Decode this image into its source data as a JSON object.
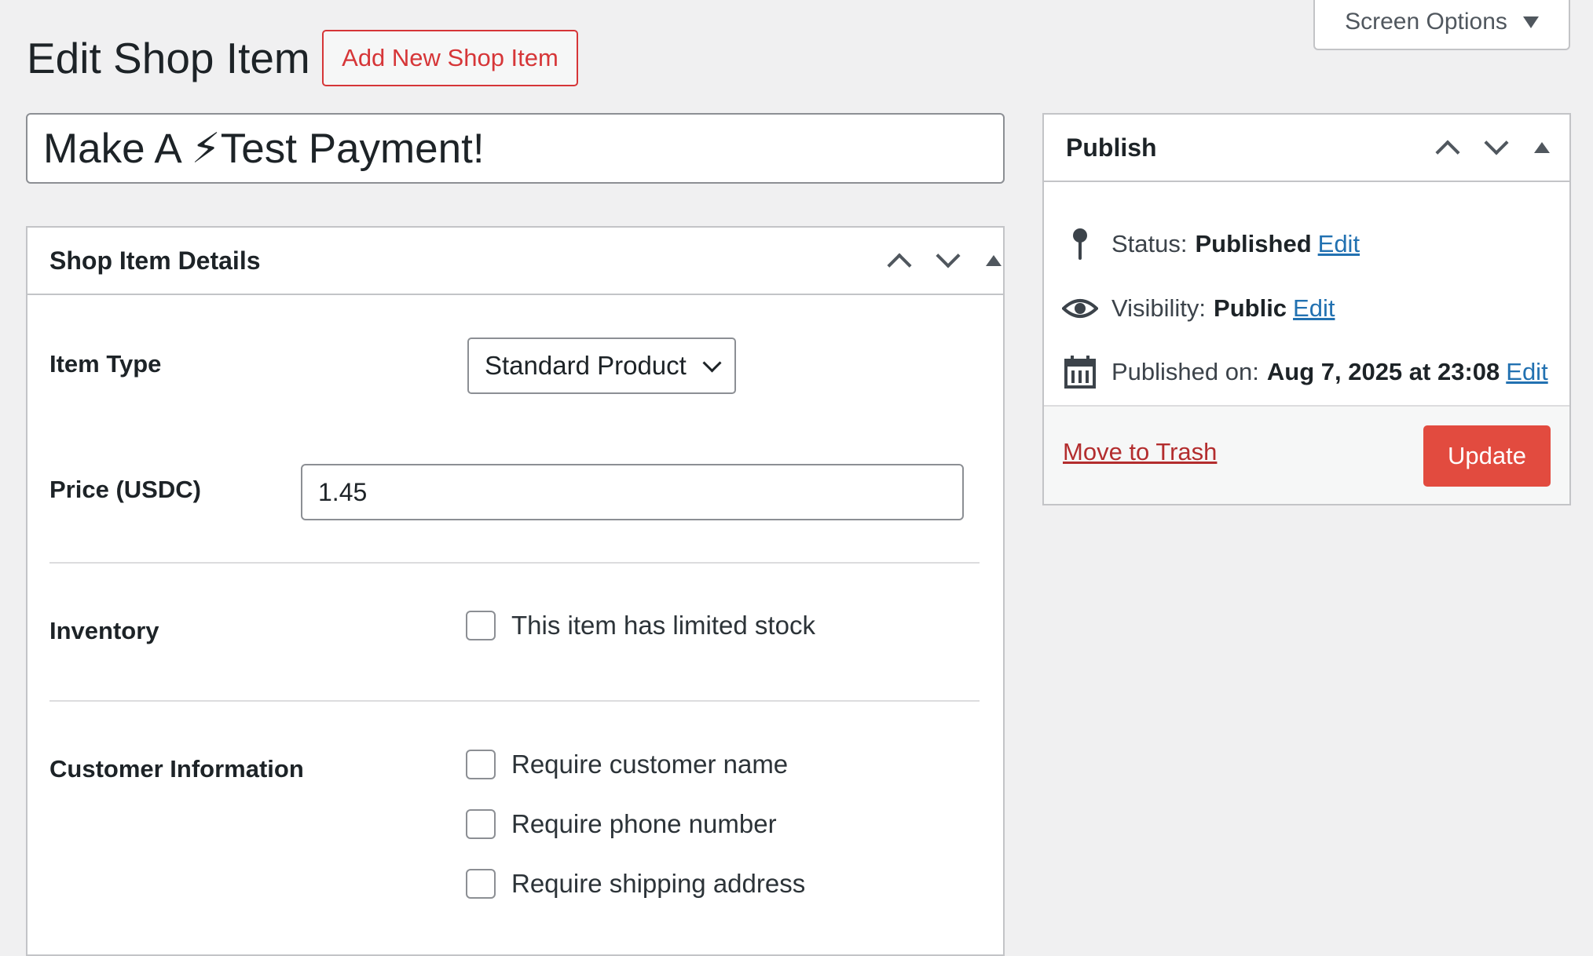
{
  "header": {
    "title": "Edit Shop Item",
    "add_new_label": "Add New Shop Item",
    "screen_options_label": "Screen Options"
  },
  "post_title": "Make A ⚡Test Payment!",
  "details": {
    "heading": "Shop Item Details",
    "item_type_label": "Item Type",
    "item_type_value": "Standard Product",
    "price_label": "Price (USDC)",
    "price_value": "1.45",
    "inventory_label": "Inventory",
    "limited_stock_label": "This item has limited stock",
    "customer_info_label": "Customer Information",
    "customer_options": [
      "Require customer name",
      "Require phone number",
      "Require shipping address"
    ]
  },
  "publish": {
    "heading": "Publish",
    "status_label": "Status:",
    "status_value": "Published",
    "visibility_label": "Visibility:",
    "visibility_value": "Public",
    "published_on_label": "Published on:",
    "published_on_value": "Aug 7, 2025 at 23:08",
    "edit_label": "Edit",
    "trash_label": "Move to Trash",
    "update_label": "Update"
  },
  "colors": {
    "accent_red": "#d63638",
    "update_button": "#e24b3f",
    "link_blue": "#2271b1",
    "trash_red": "#b32d2e"
  },
  "icons": [
    "pin-icon",
    "eye-icon",
    "calendar-icon",
    "chevron-up-icon",
    "chevron-down-icon",
    "toggle-triangle-icon",
    "lightning-emoji"
  ]
}
